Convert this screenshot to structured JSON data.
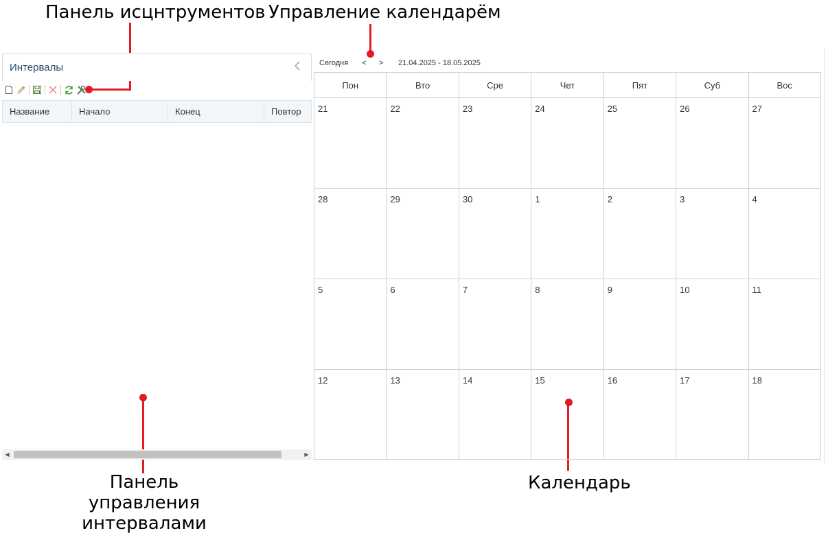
{
  "callouts": {
    "toolbar": "Панель исцнтрументов",
    "calendar_control": "Управление календарём",
    "intervals_panel": [
      "Панель",
      "управления",
      "интервалами"
    ],
    "calendar": "Календарь"
  },
  "intervals": {
    "title": "Интервалы",
    "collapse_icon": "chevron-left-icon",
    "toolbar_icons": [
      "new-document-icon",
      "edit-pencil-icon",
      "save-floppy-icon",
      "delete-cross-icon",
      "refresh-icon",
      "tools-icon"
    ],
    "columns": [
      "Название",
      "Начало",
      "Конец",
      "Повтор"
    ]
  },
  "calendar": {
    "today_label": "Сегодня",
    "prev_label": "<",
    "next_label": ">",
    "range": "21.04.2025 - 18.05.2025",
    "weekdays": [
      "Пон",
      "Вто",
      "Сре",
      "Чет",
      "Пят",
      "Суб",
      "Вос"
    ],
    "weeks": [
      [
        "21",
        "22",
        "23",
        "24",
        "25",
        "26",
        "27"
      ],
      [
        "28",
        "29",
        "30",
        "1",
        "2",
        "3",
        "4"
      ],
      [
        "5",
        "6",
        "7",
        "8",
        "9",
        "10",
        "11"
      ],
      [
        "12",
        "13",
        "14",
        "15",
        "16",
        "17",
        "18"
      ]
    ]
  },
  "colors": {
    "callout_red": "#e21b23",
    "title_blue": "#2c4a6e",
    "grid_header_bg": "#f1f6fa"
  }
}
